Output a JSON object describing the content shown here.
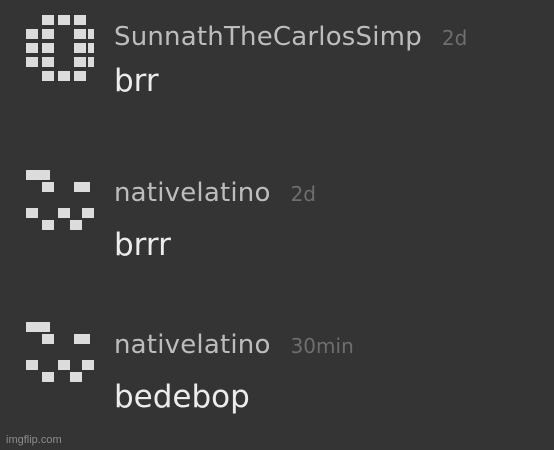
{
  "comments": [
    {
      "username": "SunnathTheCarlosSimp",
      "time": "2d",
      "text": "brr",
      "avatar_icon": "pixel-avatar-icon"
    },
    {
      "username": "nativelatino",
      "time": "2d",
      "text": "brrr",
      "avatar_icon": "pixel-avatar-icon"
    },
    {
      "username": "nativelatino",
      "time": "30min",
      "text": "bedebop",
      "avatar_icon": "pixel-avatar-icon"
    }
  ],
  "watermark": "imgflip.com",
  "colors": {
    "background": "#343434",
    "username": "#bdbdbd",
    "timestamp": "#6e6e6e",
    "comment_text": "#ececec",
    "avatar": "#dcdcdc"
  }
}
